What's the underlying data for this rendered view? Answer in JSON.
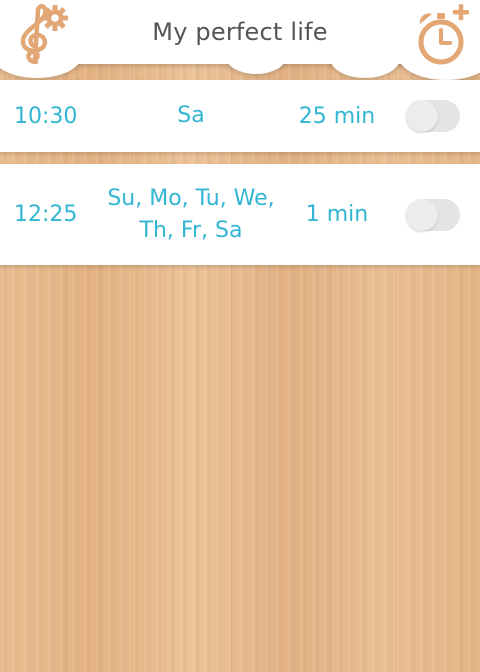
{
  "header": {
    "title": "My perfect life",
    "settings_icon": "music-settings-icon",
    "add_alarm_icon": "add-alarm-icon",
    "accent_color": "#e3a675"
  },
  "alarms": [
    {
      "time": "10:30",
      "days": "Sa",
      "duration": "25 min",
      "enabled": false
    },
    {
      "time": "12:25",
      "days": "Su, Mo, Tu, We,\nTh, Fr, Sa",
      "duration": "1 min",
      "enabled": false
    }
  ],
  "colors": {
    "text_accent": "#33b5d4",
    "title_text": "#555555",
    "toggle_off": "#e4e4e4"
  }
}
